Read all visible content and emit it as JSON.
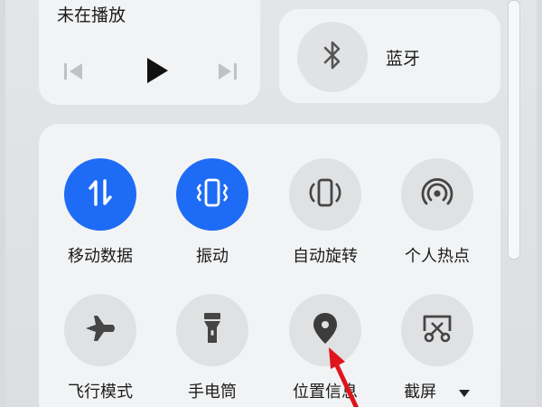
{
  "media": {
    "status": "未在播放",
    "prev_icon": "skip-previous-icon",
    "play_icon": "play-icon",
    "next_icon": "skip-next-icon"
  },
  "bluetooth": {
    "label": "蓝牙",
    "icon": "bluetooth-icon"
  },
  "tiles": [
    {
      "label": "移动数据",
      "icon": "mobile-data-icon",
      "active": true
    },
    {
      "label": "振动",
      "icon": "vibrate-icon",
      "active": true
    },
    {
      "label": "自动旋转",
      "icon": "auto-rotate-icon",
      "active": false
    },
    {
      "label": "个人热点",
      "icon": "hotspot-icon",
      "active": false
    },
    {
      "label": "飞行模式",
      "icon": "airplane-icon",
      "active": false
    },
    {
      "label": "手电筒",
      "icon": "flashlight-icon",
      "active": false
    },
    {
      "label": "位置信息",
      "icon": "location-icon",
      "active": false
    },
    {
      "label": "截屏",
      "icon": "screenshot-icon",
      "active": false
    }
  ],
  "colors": {
    "accent": "#1e6cf5",
    "tile_off": "#e0e1e3",
    "annotation_arrow": "#e0141c"
  }
}
